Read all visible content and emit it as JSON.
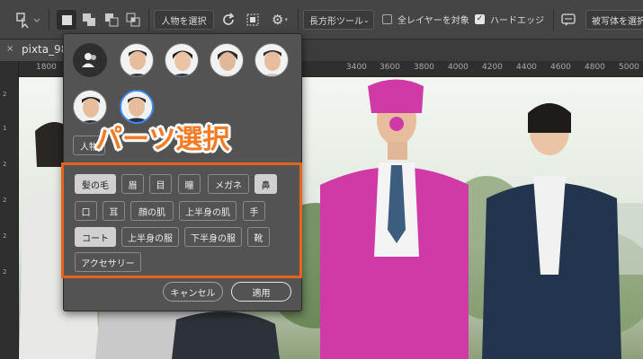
{
  "colors": {
    "accent_orange": "#e8621c",
    "callout_text": "#f47a24",
    "panel_bg": "#535353",
    "toolbar_bg": "#454545",
    "magenta_mask": "#cf3aa6"
  },
  "optionbar": {
    "select_subject_label": "人物を選択",
    "tool_dropdown_label": "長方形ツール",
    "all_layers_label": "全レイヤーを対象",
    "all_layers_checked": false,
    "hard_edge_label": "ハードエッジ",
    "hard_edge_checked": true,
    "select_subject_right_label": "被写体を選択"
  },
  "document": {
    "tab_title": "pixta_98"
  },
  "ruler": {
    "h_ticks": [
      "1800",
      "3400",
      "3600",
      "3800",
      "4000",
      "4200",
      "4400",
      "4600",
      "4800",
      "5000"
    ],
    "v_ticks": [
      "2",
      "1",
      "2",
      "2",
      "2",
      "2"
    ]
  },
  "panel": {
    "person_button_label": "人物",
    "parts": [
      {
        "label": "髪の毛",
        "selected": true
      },
      {
        "label": "眉",
        "selected": false
      },
      {
        "label": "目",
        "selected": false
      },
      {
        "label": "瞳",
        "selected": false
      },
      {
        "label": "メガネ",
        "selected": false
      },
      {
        "label": "鼻",
        "selected": true
      },
      {
        "label": "口",
        "selected": false
      },
      {
        "label": "耳",
        "selected": false
      },
      {
        "label": "顔の肌",
        "selected": false
      },
      {
        "label": "上半身の肌",
        "selected": false
      },
      {
        "label": "手",
        "selected": false
      },
      {
        "label": "コート",
        "selected": true
      },
      {
        "label": "上半身の服",
        "selected": false
      },
      {
        "label": "下半身の服",
        "selected": false
      },
      {
        "label": "靴",
        "selected": false
      },
      {
        "label": "アクセサリー",
        "selected": false
      }
    ],
    "cancel_label": "キャンセル",
    "apply_label": "適用"
  },
  "callout": {
    "text": "パーツ選択"
  }
}
